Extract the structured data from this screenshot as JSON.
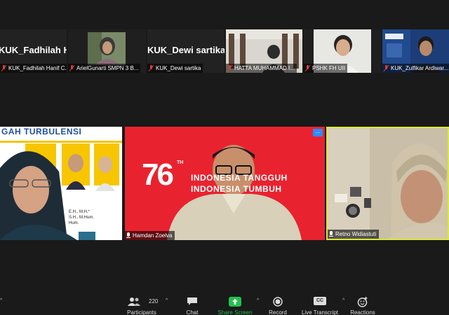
{
  "participants_strip": [
    {
      "name": "KUK_Fadhilah Hanif C...",
      "big_name": "KUK_Fadhilah  H..."
    },
    {
      "name": "ArielGunarti SMPN 3 B..."
    },
    {
      "name": "KUK_Dewi sartika",
      "big_name": "KUK_Dewi sartika"
    },
    {
      "name": "HATTA MUHAMMAD I..."
    },
    {
      "name": "PSHK FH UII"
    },
    {
      "name": "KUK_Zulfikar Ardiwar..."
    }
  ],
  "main_tiles": [
    {
      "name": "",
      "banner": "GAH TURBULENSI",
      "lines": [
        "E.H., M.H.*",
        "S.H., M.Hum.",
        "Hum."
      ]
    },
    {
      "name": "Hamdan Zoelva",
      "number": "76",
      "th": "TH",
      "line1": "INDONESIA TANGGUH",
      "line2": "INDONESIA TUMBUH",
      "more": "..."
    },
    {
      "name": "Retno Widiastuti"
    }
  ],
  "toolbar": {
    "participants_count": "220",
    "participants": "Participants",
    "chat": "Chat",
    "share_screen": "Share Screen",
    "record": "Record",
    "live_transcript": "Live Transcript",
    "cc": "CC",
    "reactions": "Reactions"
  },
  "colors": {
    "share_green": "#23c04d",
    "active_speaker": "#d8e838",
    "muted_red": "#e23b3b",
    "banner_red": "#e8232f"
  }
}
